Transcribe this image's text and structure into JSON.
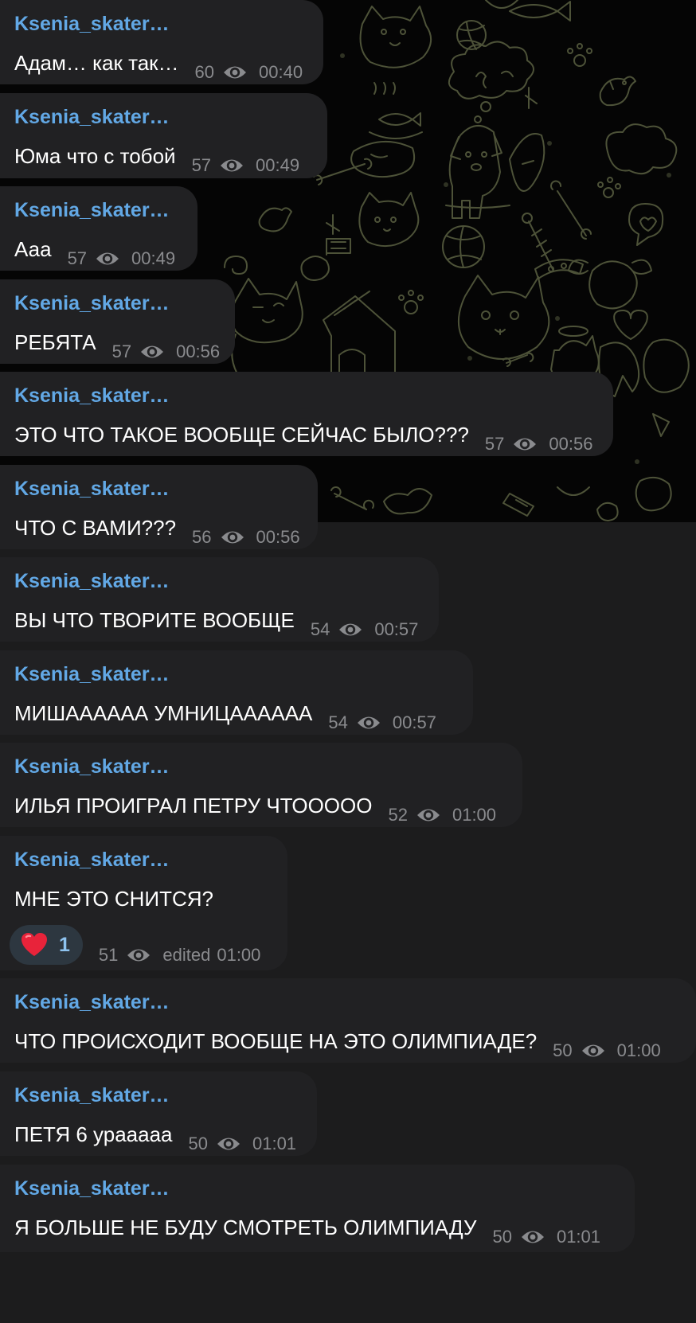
{
  "colors": {
    "sender": "#62a8e5",
    "bubble": "#212123",
    "meta": "#8a8b8e",
    "text": "#ffffff",
    "reaction_bg": "#2d3740",
    "reaction_count": "#8ec3ef",
    "wallpaper": "#050505",
    "wallpaper_doodle": "#5a6042"
  },
  "icons": {
    "views": "eye-icon",
    "reaction": "heart-emoji"
  },
  "messages": [
    {
      "sender": "Ksenia_skater…",
      "text": "Адам… как так…",
      "views": "60",
      "time": "00:40"
    },
    {
      "sender": "Ksenia_skater…",
      "text": "Юма что с тобой",
      "views": "57",
      "time": "00:49"
    },
    {
      "sender": "Ksenia_skater…",
      "text": "Ааа",
      "views": "57",
      "time": "00:49"
    },
    {
      "sender": "Ksenia_skater…",
      "text": "РЕБЯТА",
      "views": "57",
      "time": "00:56"
    },
    {
      "sender": "Ksenia_skater…",
      "text": "ЭТО ЧТО ТАКОЕ ВООБЩЕ СЕЙЧАС БЫЛО???",
      "views": "57",
      "time": "00:56"
    },
    {
      "sender": "Ksenia_skater…",
      "text": "ЧТО С ВАМИ???",
      "views": "56",
      "time": "00:56"
    },
    {
      "sender": "Ksenia_skater…",
      "text": "ВЫ ЧТО ТВОРИТЕ ВООБЩЕ",
      "views": "54",
      "time": "00:57"
    },
    {
      "sender": "Ksenia_skater…",
      "text": "МИШАААААА УМНИЦАААААА",
      "views": "54",
      "time": "00:57"
    },
    {
      "sender": "Ksenia_skater…",
      "text": "ИЛЬЯ ПРОИГРАЛ ПЕТРУ ЧТООООО",
      "views": "52",
      "time": "01:00"
    },
    {
      "sender": "Ksenia_skater…",
      "text": "МНЕ ЭТО СНИТСЯ?",
      "views": "51",
      "edited": "edited",
      "time": "01:00",
      "reaction": {
        "emoji": "❤️",
        "count": "1"
      }
    },
    {
      "sender": "Ksenia_skater…",
      "text": "ЧТО ПРОИСХОДИТ ВООБЩЕ НА ЭТО ОЛИМПИАДЕ?",
      "views": "50",
      "time": "01:00"
    },
    {
      "sender": "Ksenia_skater…",
      "text": "ПЕТЯ 6 урааааа",
      "views": "50",
      "time": "01:01"
    },
    {
      "sender": "Ksenia_skater…",
      "text": "Я БОЛЬШЕ НЕ БУДУ СМОТРЕТЬ ОЛИМПИАДУ",
      "views": "50",
      "time": "01:01"
    }
  ]
}
